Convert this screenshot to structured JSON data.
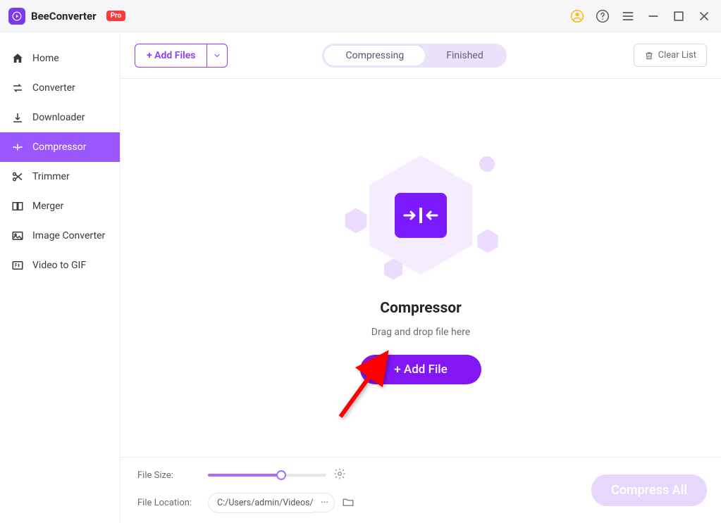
{
  "app": {
    "name": "BeeConverter",
    "badge": "Pro"
  },
  "sidebar": {
    "items": [
      {
        "label": "Home"
      },
      {
        "label": "Converter"
      },
      {
        "label": "Downloader"
      },
      {
        "label": "Compressor"
      },
      {
        "label": "Trimmer"
      },
      {
        "label": "Merger"
      },
      {
        "label": "Image Converter"
      },
      {
        "label": "Video to GIF"
      }
    ]
  },
  "toolbar": {
    "add_files_label": "+ Add Files",
    "tabs": {
      "compressing": "Compressing",
      "finished": "Finished"
    },
    "clear_label": "Clear List"
  },
  "drop": {
    "title": "Compressor",
    "subtitle": "Drag and drop file here",
    "add_file_label": "+ Add File"
  },
  "bottom": {
    "file_size_label": "File Size:",
    "file_location_label": "File Location:",
    "file_location_value": "C:/Users/admin/Videos/",
    "ellipsis": "···",
    "compress_all_label": "Compress All"
  }
}
